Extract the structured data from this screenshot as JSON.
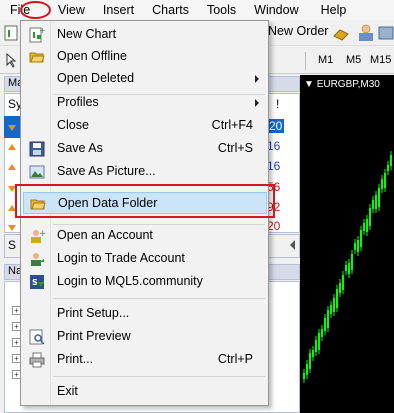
{
  "menubar": {
    "items": [
      "File",
      "View",
      "Insert",
      "Charts",
      "Tools",
      "Window",
      "Help"
    ]
  },
  "toolbar": {
    "new_order_label": "New Order",
    "periods": [
      "M1",
      "M5",
      "M15"
    ]
  },
  "market_watch": {
    "title": "Ma",
    "col_header": "Sy",
    "row_numbers": [
      "20",
      "16",
      "16",
      "56",
      "92",
      "20"
    ]
  },
  "navigator": {
    "title": "Nav"
  },
  "chart": {
    "title": "EURGBP,M30",
    "background": "#000000",
    "candle_color": "#00ff00"
  },
  "file_menu": {
    "items": [
      {
        "label": "New Chart",
        "shortcut": "",
        "submenu": false
      },
      {
        "label": "Open Offline",
        "shortcut": "",
        "submenu": false
      },
      {
        "label": "Open Deleted",
        "shortcut": "",
        "submenu": true
      },
      {
        "label": "Profiles",
        "shortcut": "",
        "submenu": true
      },
      {
        "label": "Close",
        "shortcut": "Ctrl+F4",
        "submenu": false
      },
      {
        "label": "Save As",
        "shortcut": "Ctrl+S",
        "submenu": false
      },
      {
        "label": "Save As Picture...",
        "shortcut": "",
        "submenu": false
      },
      {
        "label": "Open Data Folder",
        "shortcut": "",
        "submenu": false
      },
      {
        "label": "Open an Account",
        "shortcut": "",
        "submenu": false
      },
      {
        "label": "Login to Trade Account",
        "shortcut": "",
        "submenu": false
      },
      {
        "label": "Login to MQL5.community",
        "shortcut": "",
        "submenu": false
      },
      {
        "label": "Print Setup...",
        "shortcut": "",
        "submenu": false
      },
      {
        "label": "Print Preview",
        "shortcut": "",
        "submenu": false
      },
      {
        "label": "Print...",
        "shortcut": "Ctrl+P",
        "submenu": false
      },
      {
        "label": "Exit",
        "shortcut": "",
        "submenu": false
      }
    ],
    "highlight_color": "#d9141f"
  }
}
